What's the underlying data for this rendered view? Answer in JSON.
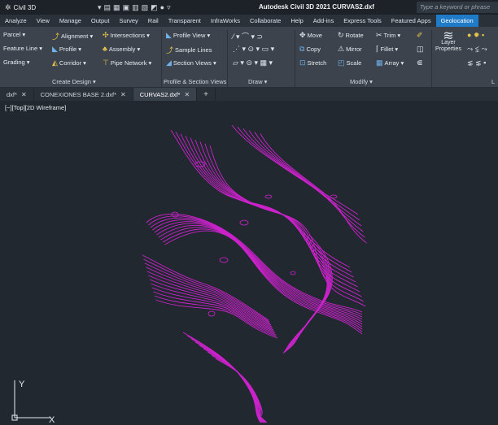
{
  "titlebar": {
    "workspace": "Civil 3D",
    "app_title": "Autodesk Civil 3D 2021   CURVAS2.dxf",
    "search_placeholder": "Type a keyword or phrase"
  },
  "ribbon_tabs": [
    "Analyze",
    "View",
    "Manage",
    "Output",
    "Survey",
    "Rail",
    "Transparent",
    "InfraWorks",
    "Collaborate",
    "Help",
    "Add-ins",
    "Express Tools",
    "Featured Apps",
    "Geolocation"
  ],
  "ribbon_active_tab": "Geolocation",
  "ribbon": {
    "parcel": "Parcel ▾",
    "feature_line": "Feature Line ▾",
    "grading": "Grading ▾",
    "alignment": "Alignment ▾",
    "profile": "Profile ▾",
    "corridor": "Corridor ▾",
    "intersections": "Intersections ▾",
    "assembly": "Assembly ▾",
    "pipe_network": "Pipe Network ▾",
    "create_design": "Create Design ▾",
    "profile_view": "Profile View ▾",
    "sample_lines": "Sample Lines",
    "section_views": "Section Views ▾",
    "profile_section_views": "Profile & Section Views",
    "draw": "Draw ▾",
    "move": "Move",
    "rotate": "Rotate",
    "trim": "Trim ▾",
    "copy": "Copy",
    "mirror": "Mirror",
    "fillet": "Fillet ▾",
    "stretch": "Stretch",
    "scale": "Scale",
    "array": "Array ▾",
    "modify": "Modify ▾",
    "layer_properties": "Layer Properties",
    "layers_short": "L"
  },
  "file_tabs": [
    {
      "label": "dxf*",
      "active": false
    },
    {
      "label": "CONEXIONES BASE 2.dxf*",
      "active": false
    },
    {
      "label": "CURVAS2.dxf*",
      "active": true
    }
  ],
  "viewport_label": "[−][Top][2D Wireframe]",
  "ucs": {
    "y_label": "Y",
    "x_label": "X"
  },
  "colors": {
    "contour": "#cc22cc",
    "canvas": "#212830",
    "accent": "#1f7bc8"
  }
}
